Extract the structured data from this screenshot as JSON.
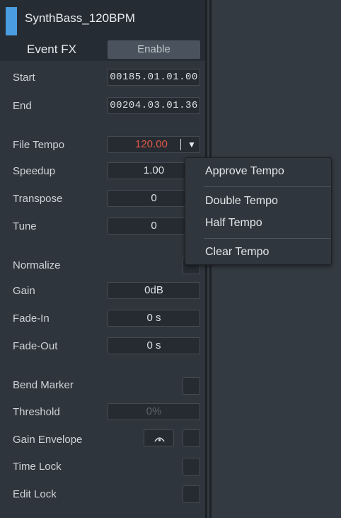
{
  "panel": {
    "title": "SynthBass_120BPM",
    "event_fx_label": "Event FX",
    "enable_label": "Enable",
    "accent_color": "#4a9de0"
  },
  "fields": {
    "start": {
      "label": "Start",
      "value": "00185.01.01.00"
    },
    "end": {
      "label": "End",
      "value": "00204.03.01.36"
    },
    "file_tempo": {
      "label": "File Tempo",
      "value": "120.00"
    },
    "speedup": {
      "label": "Speedup",
      "value": "1.00"
    },
    "transpose": {
      "label": "Transpose",
      "value": "0"
    },
    "tune": {
      "label": "Tune",
      "value": "0"
    },
    "normalize": {
      "label": "Normalize"
    },
    "gain": {
      "label": "Gain",
      "value": "0dB"
    },
    "fade_in": {
      "label": "Fade-In",
      "value": "0 s"
    },
    "fade_out": {
      "label": "Fade-Out",
      "value": "0 s"
    },
    "bend_marker": {
      "label": "Bend Marker"
    },
    "threshold": {
      "label": "Threshold",
      "value": "0%"
    },
    "gain_envelope": {
      "label": "Gain Envelope"
    },
    "time_lock": {
      "label": "Time Lock"
    },
    "edit_lock": {
      "label": "Edit Lock"
    }
  },
  "tempo_color": "#e0584a",
  "icons": {
    "dropdown": "triangle-down-icon",
    "envelope": "arc-envelope-icon"
  },
  "tempo_menu": {
    "items": [
      "Approve Tempo",
      "Double Tempo",
      "Half Tempo",
      "Clear Tempo"
    ]
  }
}
